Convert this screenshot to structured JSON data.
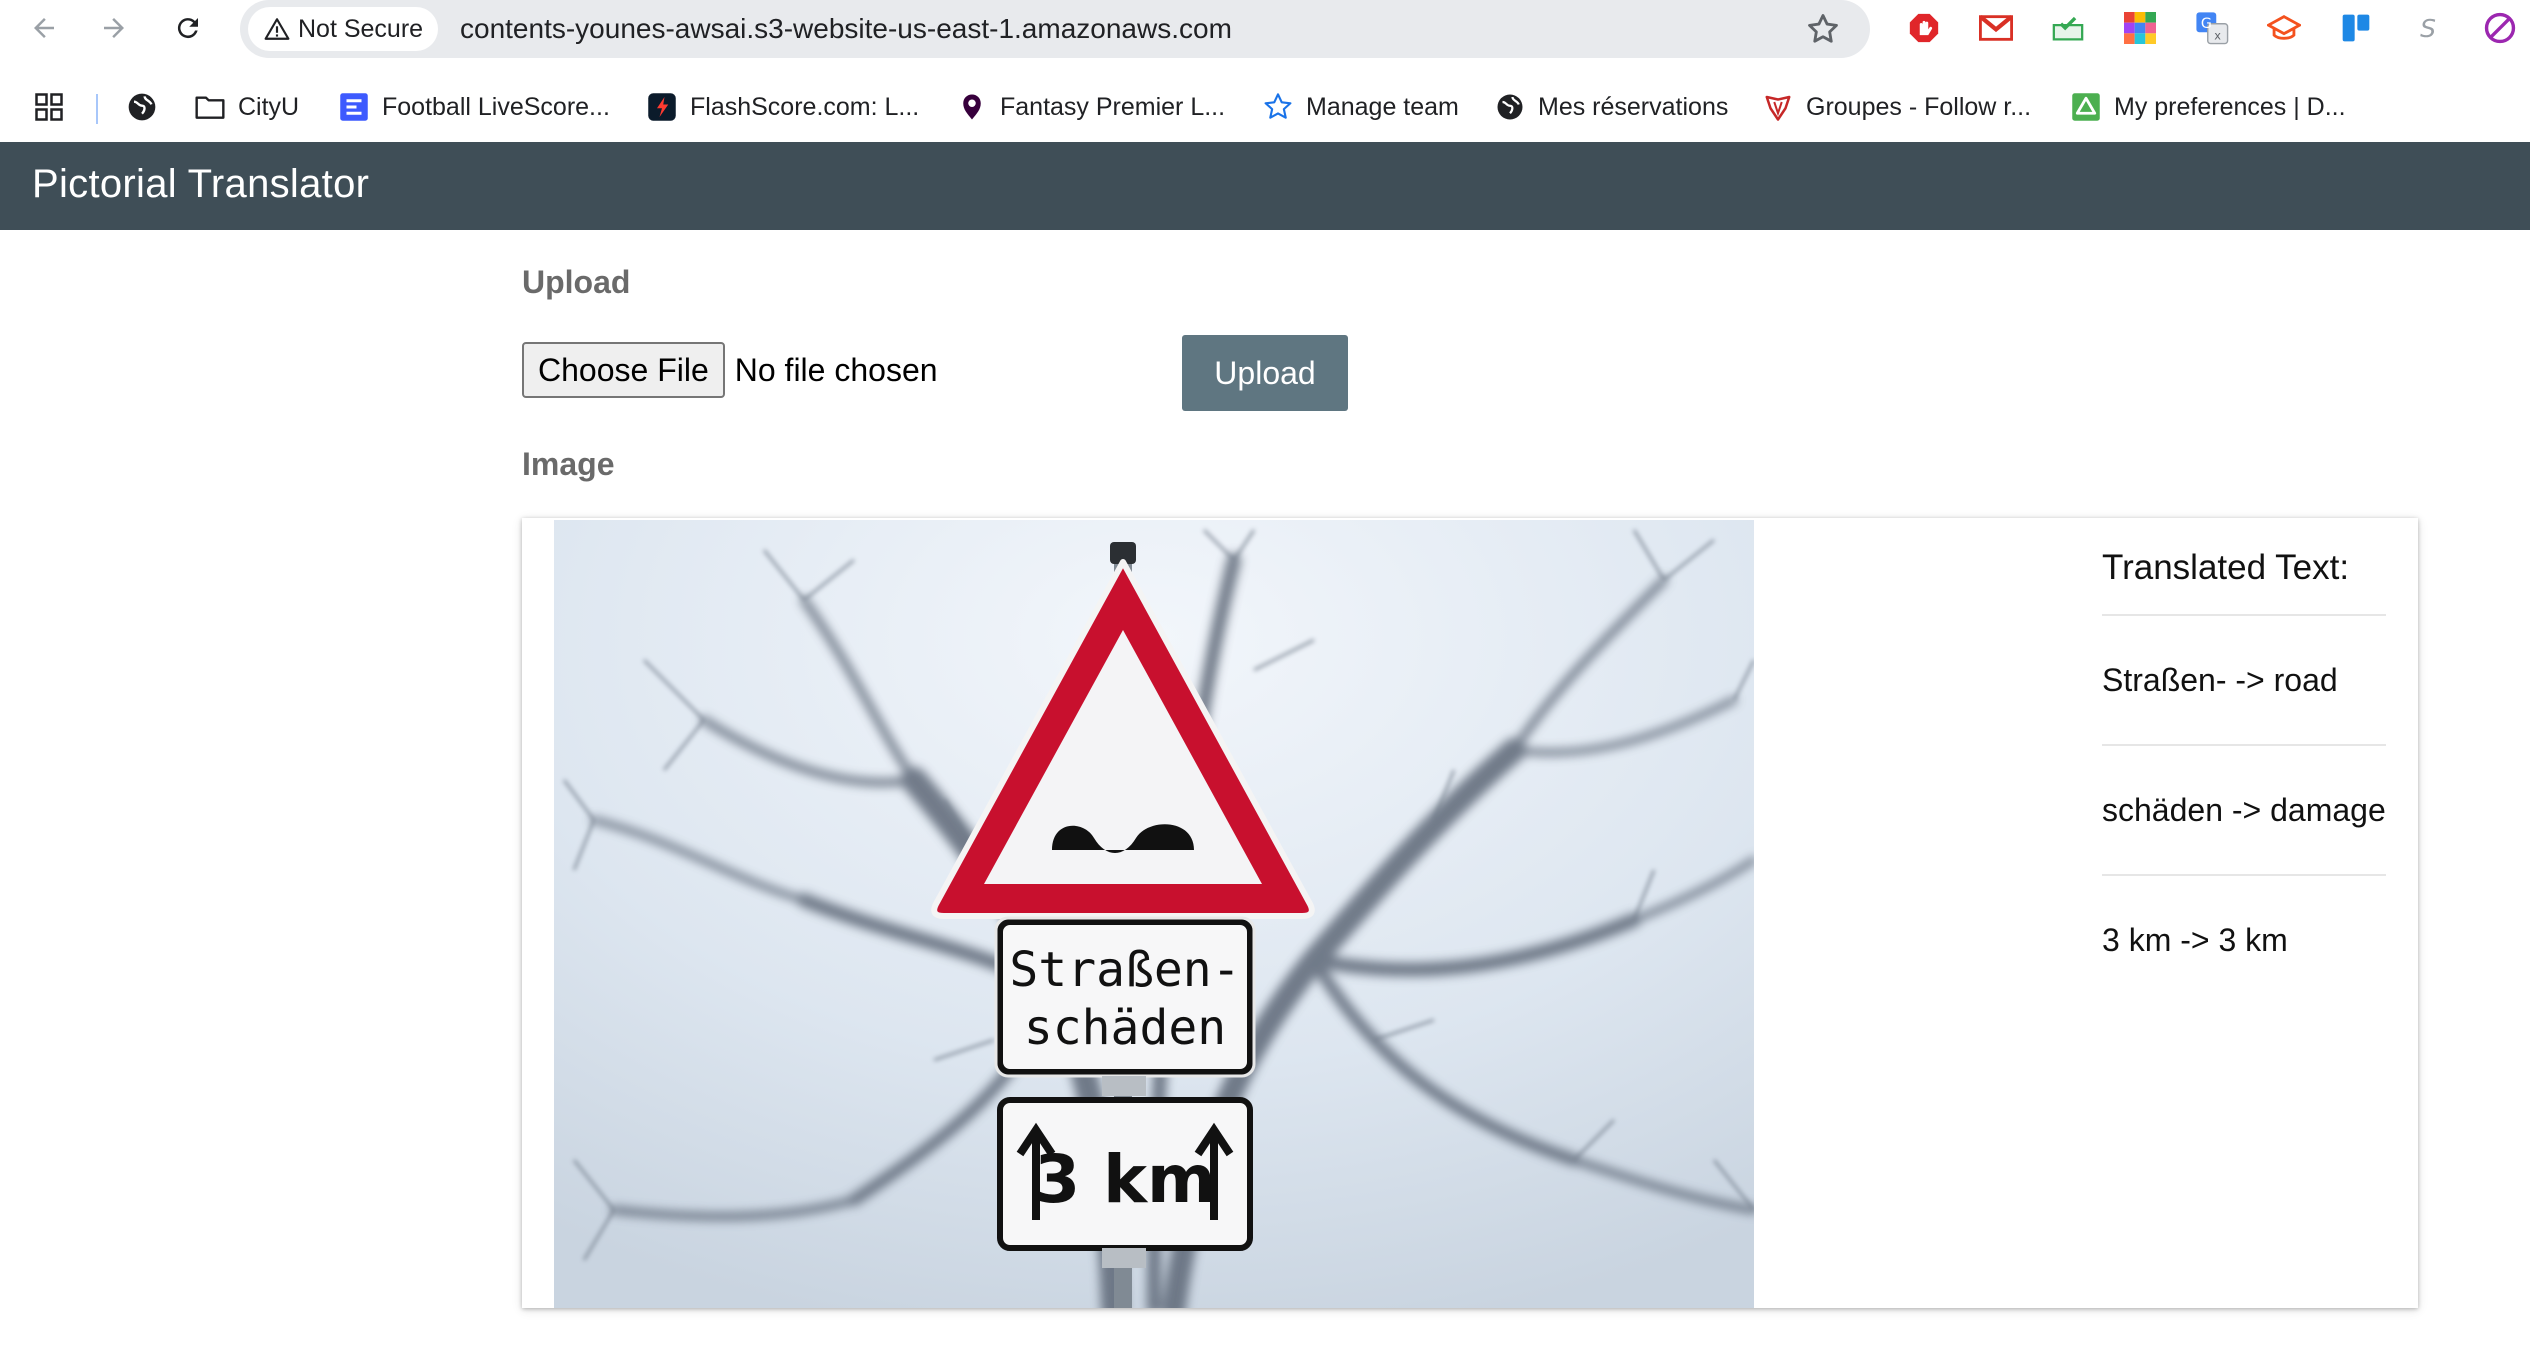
{
  "browser": {
    "security_label": "Not Secure",
    "url": "contents-younes-awsai.s3-website-us-east-1.amazonaws.com",
    "bookmarks": [
      {
        "label": "CityU",
        "icon": "folder-icon"
      },
      {
        "label": "Football LiveScore...",
        "icon": "livescore-favicon"
      },
      {
        "label": "FlashScore.com: L...",
        "icon": "flashscore-favicon"
      },
      {
        "label": "Fantasy Premier L...",
        "icon": "premier-league-favicon"
      },
      {
        "label": "Manage team",
        "icon": "star-outline-favicon"
      },
      {
        "label": "Mes réservations",
        "icon": "globe-favicon"
      },
      {
        "label": "Groupes - Follow r...",
        "icon": "groupes-favicon"
      },
      {
        "label": "My preferences | D...",
        "icon": "drive-favicon"
      }
    ]
  },
  "app": {
    "title": "Pictorial Translator",
    "upload_heading": "Upload",
    "choose_file_label": "Choose File",
    "file_status": "No file chosen",
    "upload_button": "Upload",
    "image_heading": "Image"
  },
  "photo": {
    "sign_text_line1": "Straßen-",
    "sign_text_line2": "schäden",
    "sign_distance": "3 km"
  },
  "translation": {
    "title": "Translated Text:",
    "items": [
      "Straßen- -> road",
      "schäden -> damage",
      "3 km -> 3 km"
    ]
  },
  "colors": {
    "header_bg": "#3f4e57",
    "upload_button_bg": "#5f7681",
    "heading_text": "#6a6a6a"
  }
}
